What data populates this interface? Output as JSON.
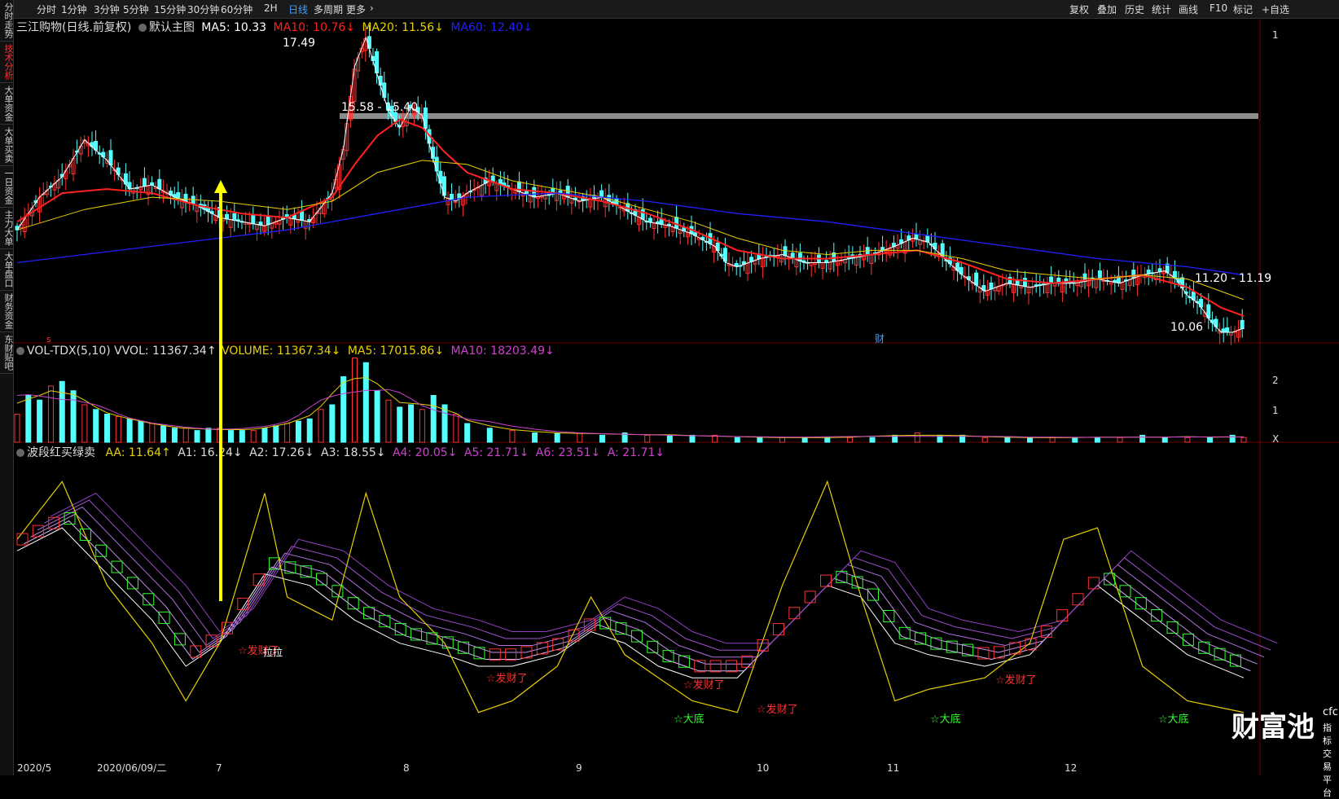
{
  "sidebar": {
    "tabs": [
      "分时走势",
      "技术分析",
      "大单资金",
      "大单买卖",
      "一日资金",
      "主力大单",
      "大单盘口",
      "财务资金",
      "东财贴吧"
    ],
    "active": 1
  },
  "toolbar": {
    "periods": [
      "分时",
      "1分钟",
      "3分钟",
      "5分钟",
      "15分钟",
      "30分钟",
      "60分钟",
      "2H",
      "日线",
      "多周期",
      "更多"
    ],
    "active_period": "日线",
    "right_buttons": [
      "复权",
      "叠加",
      "历史",
      "统计",
      "画线",
      "F10",
      "标记",
      "+自选"
    ]
  },
  "main_panel": {
    "title": "三江购物(日线.前复权)",
    "template": "默认主图",
    "ma5": "MA5: 10.33",
    "ma10": "MA10: 10.76↓",
    "ma20": "MA20: 11.56↓",
    "ma60": "MA60: 12.40↓",
    "high_label": "17.49",
    "range_label_1": "15.58 - 15.40",
    "range_label_2": "11.20 - 11.19",
    "low_label": "10.06",
    "marker_cai": "财",
    "marker_s": "s",
    "right_axis_1": "1"
  },
  "vol_panel": {
    "title": "VOL-TDX(5,10) VVOL: 11367.34↑",
    "volume": "VOLUME: 11367.34↓",
    "ma5": "MA5: 17015.86↓",
    "ma10": "MA10: 18203.49↓",
    "right_axis_1": "2",
    "right_axis_2": "1",
    "right_axis_3": "X"
  },
  "ind_panel": {
    "title": "波段红买绿卖",
    "aa": "AA: 11.64↑",
    "a1": "A1: 16.24↓",
    "a2": "A2: 17.26↓",
    "a3": "A3: 18.55↓",
    "a4": "A4: 20.05↓",
    "a5": "A5: 21.71↓",
    "a6": "A6: 23.51↓",
    "a": "A: 21.71↓",
    "signals": [
      "☆发财了",
      "☆发财了",
      "☆发财了",
      "☆发财了",
      "☆发财了"
    ],
    "bottoms": [
      "☆大底",
      "☆大底",
      "☆大底"
    ],
    "pull_label": "拉拉"
  },
  "x_axis": {
    "labels": [
      "2020/5",
      "2020/06/09/二",
      "7",
      "8",
      "9",
      "10",
      "11",
      "12"
    ]
  },
  "watermark": {
    "logo": "财富池",
    "url": "cfchi.com",
    "sub": "指标交易平台"
  },
  "colors": {
    "up": "#ff3232",
    "down": "#54ffff",
    "ma5": "#ffffff",
    "ma10": "#ff2020",
    "ma20": "#e8d000",
    "ma60": "#2020ff",
    "vol_ma5": "#e8d000",
    "vol_ma10": "#d040d0",
    "arrow": "#ffff00",
    "resistance": "#8c8c8c",
    "signal": "#ff3030",
    "bottom": "#30ff30"
  },
  "chart_data": {
    "type": "candlestick",
    "title": "三江购物(日线.前复权)",
    "price_range": [
      10.0,
      17.6
    ],
    "high": 17.49,
    "low": 10.06,
    "close_pts": [
      [
        0,
        12.6
      ],
      [
        10,
        13.4
      ],
      [
        20,
        13.9
      ],
      [
        30,
        14.8
      ],
      [
        40,
        14.3
      ],
      [
        50,
        13.6
      ],
      [
        60,
        13.7
      ],
      [
        70,
        13.4
      ],
      [
        80,
        13.2
      ],
      [
        90,
        12.9
      ],
      [
        100,
        12.8
      ],
      [
        110,
        12.7
      ],
      [
        120,
        12.9
      ],
      [
        130,
        12.8
      ],
      [
        140,
        13.5
      ],
      [
        145,
        14.6
      ],
      [
        150,
        16.6
      ],
      [
        155,
        17.3
      ],
      [
        160,
        16.4
      ],
      [
        165,
        15.5
      ],
      [
        170,
        15.1
      ],
      [
        175,
        15.6
      ],
      [
        180,
        15.4
      ],
      [
        185,
        14.3
      ],
      [
        190,
        13.4
      ],
      [
        195,
        13.3
      ],
      [
        200,
        13.5
      ],
      [
        210,
        13.8
      ],
      [
        220,
        13.6
      ],
      [
        230,
        13.4
      ],
      [
        240,
        13.5
      ],
      [
        250,
        13.3
      ],
      [
        260,
        13.4
      ],
      [
        270,
        13.1
      ],
      [
        280,
        12.8
      ],
      [
        290,
        12.7
      ],
      [
        300,
        12.5
      ],
      [
        310,
        12.2
      ],
      [
        315,
        11.8
      ],
      [
        320,
        11.7
      ],
      [
        330,
        11.9
      ],
      [
        340,
        12.0
      ],
      [
        350,
        11.8
      ],
      [
        360,
        11.8
      ],
      [
        370,
        11.9
      ],
      [
        380,
        12.0
      ],
      [
        390,
        12.2
      ],
      [
        398,
        12.4
      ],
      [
        405,
        12.3
      ],
      [
        412,
        11.9
      ],
      [
        420,
        11.5
      ],
      [
        430,
        11.1
      ],
      [
        440,
        11.3
      ],
      [
        450,
        11.2
      ],
      [
        460,
        11.3
      ],
      [
        470,
        11.3
      ],
      [
        480,
        11.4
      ],
      [
        490,
        11.3
      ],
      [
        500,
        11.5
      ],
      [
        510,
        11.6
      ],
      [
        515,
        11.4
      ],
      [
        520,
        11.0
      ],
      [
        525,
        10.8
      ],
      [
        530,
        10.4
      ],
      [
        535,
        10.1
      ],
      [
        540,
        10.1
      ],
      [
        545,
        10.2
      ]
    ],
    "ma10_pts": [
      [
        0,
        12.8
      ],
      [
        20,
        13.5
      ],
      [
        40,
        13.6
      ],
      [
        60,
        13.5
      ],
      [
        80,
        13.2
      ],
      [
        100,
        13.0
      ],
      [
        120,
        12.9
      ],
      [
        140,
        13.4
      ],
      [
        150,
        14.2
      ],
      [
        160,
        14.9
      ],
      [
        170,
        15.3
      ],
      [
        180,
        15.1
      ],
      [
        190,
        14.5
      ],
      [
        200,
        14.0
      ],
      [
        210,
        13.8
      ],
      [
        220,
        13.6
      ],
      [
        240,
        13.5
      ],
      [
        260,
        13.3
      ],
      [
        280,
        13.0
      ],
      [
        300,
        12.6
      ],
      [
        320,
        12.1
      ],
      [
        340,
        11.9
      ],
      [
        360,
        11.9
      ],
      [
        380,
        12.0
      ],
      [
        400,
        12.1
      ],
      [
        420,
        11.8
      ],
      [
        440,
        11.4
      ],
      [
        460,
        11.3
      ],
      [
        480,
        11.4
      ],
      [
        500,
        11.5
      ],
      [
        520,
        11.2
      ],
      [
        535,
        10.7
      ],
      [
        545,
        10.5
      ]
    ],
    "ma20_pts": [
      [
        0,
        12.6
      ],
      [
        30,
        13.1
      ],
      [
        60,
        13.4
      ],
      [
        90,
        13.3
      ],
      [
        120,
        13.1
      ],
      [
        140,
        13.3
      ],
      [
        160,
        14.0
      ],
      [
        180,
        14.3
      ],
      [
        200,
        14.2
      ],
      [
        220,
        13.8
      ],
      [
        240,
        13.6
      ],
      [
        260,
        13.4
      ],
      [
        280,
        13.1
      ],
      [
        300,
        12.8
      ],
      [
        320,
        12.4
      ],
      [
        340,
        12.1
      ],
      [
        360,
        12.0
      ],
      [
        380,
        12.1
      ],
      [
        400,
        12.1
      ],
      [
        420,
        11.9
      ],
      [
        440,
        11.6
      ],
      [
        460,
        11.5
      ],
      [
        480,
        11.4
      ],
      [
        500,
        11.5
      ],
      [
        520,
        11.4
      ],
      [
        545,
        10.9
      ]
    ],
    "ma60_pts": [
      [
        0,
        11.8
      ],
      [
        60,
        12.2
      ],
      [
        120,
        12.6
      ],
      [
        160,
        13.0
      ],
      [
        200,
        13.4
      ],
      [
        240,
        13.5
      ],
      [
        280,
        13.3
      ],
      [
        320,
        13.0
      ],
      [
        360,
        12.8
      ],
      [
        400,
        12.5
      ],
      [
        440,
        12.2
      ],
      [
        480,
        11.9
      ],
      [
        520,
        11.7
      ],
      [
        545,
        11.5
      ]
    ],
    "volume": [
      [
        0,
        12
      ],
      [
        5,
        20
      ],
      [
        10,
        18
      ],
      [
        15,
        24
      ],
      [
        20,
        26
      ],
      [
        25,
        22
      ],
      [
        30,
        16
      ],
      [
        35,
        14
      ],
      [
        40,
        12
      ],
      [
        45,
        11
      ],
      [
        50,
        10
      ],
      [
        55,
        9
      ],
      [
        60,
        8
      ],
      [
        65,
        7
      ],
      [
        70,
        6
      ],
      [
        75,
        6
      ],
      [
        80,
        5
      ],
      [
        85,
        6
      ],
      [
        90,
        6
      ],
      [
        95,
        5
      ],
      [
        100,
        5
      ],
      [
        105,
        5
      ],
      [
        110,
        6
      ],
      [
        115,
        7
      ],
      [
        120,
        8
      ],
      [
        125,
        9
      ],
      [
        130,
        10
      ],
      [
        135,
        14
      ],
      [
        140,
        16
      ],
      [
        145,
        28
      ],
      [
        150,
        36
      ],
      [
        155,
        34
      ],
      [
        160,
        22
      ],
      [
        165,
        18
      ],
      [
        170,
        15
      ],
      [
        175,
        16
      ],
      [
        180,
        14
      ],
      [
        185,
        20
      ],
      [
        190,
        16
      ],
      [
        195,
        12
      ],
      [
        200,
        8
      ],
      [
        210,
        6
      ],
      [
        220,
        5
      ],
      [
        230,
        4
      ],
      [
        240,
        4
      ],
      [
        250,
        4
      ],
      [
        260,
        3
      ],
      [
        270,
        4
      ],
      [
        280,
        3
      ],
      [
        290,
        3
      ],
      [
        300,
        3
      ],
      [
        310,
        3
      ],
      [
        320,
        2
      ],
      [
        330,
        2
      ],
      [
        340,
        2
      ],
      [
        350,
        2
      ],
      [
        360,
        2
      ],
      [
        370,
        2
      ],
      [
        380,
        2
      ],
      [
        390,
        3
      ],
      [
        400,
        4
      ],
      [
        410,
        3
      ],
      [
        420,
        3
      ],
      [
        430,
        2
      ],
      [
        440,
        2
      ],
      [
        450,
        2
      ],
      [
        460,
        2
      ],
      [
        470,
        2
      ],
      [
        480,
        2
      ],
      [
        490,
        2
      ],
      [
        500,
        3
      ],
      [
        510,
        2
      ],
      [
        520,
        2
      ],
      [
        530,
        2
      ],
      [
        540,
        3
      ],
      [
        545,
        2
      ]
    ],
    "indicator_lines": {
      "aa": [
        [
          0,
          17
        ],
        [
          20,
          22
        ],
        [
          40,
          13
        ],
        [
          60,
          8
        ],
        [
          75,
          3
        ],
        [
          90,
          8
        ],
        [
          110,
          21
        ],
        [
          120,
          12
        ],
        [
          140,
          10
        ],
        [
          155,
          21
        ],
        [
          170,
          12
        ],
        [
          190,
          8
        ],
        [
          205,
          2
        ],
        [
          220,
          3
        ],
        [
          240,
          6
        ],
        [
          255,
          12
        ],
        [
          270,
          7
        ],
        [
          285,
          5
        ],
        [
          300,
          3
        ],
        [
          320,
          2
        ],
        [
          340,
          13
        ],
        [
          360,
          22
        ],
        [
          375,
          12
        ],
        [
          390,
          3
        ],
        [
          405,
          4
        ],
        [
          430,
          5
        ],
        [
          450,
          8
        ],
        [
          465,
          17
        ],
        [
          480,
          18
        ],
        [
          500,
          6
        ],
        [
          520,
          3
        ],
        [
          545,
          2
        ]
      ],
      "a1": [
        [
          0,
          16
        ],
        [
          20,
          18
        ],
        [
          40,
          14
        ],
        [
          60,
          10
        ],
        [
          75,
          6
        ],
        [
          90,
          8
        ],
        [
          110,
          14
        ],
        [
          130,
          13
        ],
        [
          150,
          10
        ],
        [
          170,
          8
        ],
        [
          190,
          7
        ],
        [
          205,
          6
        ],
        [
          220,
          6
        ],
        [
          240,
          7
        ],
        [
          255,
          9
        ],
        [
          270,
          8
        ],
        [
          285,
          6
        ],
        [
          300,
          5
        ],
        [
          320,
          5
        ],
        [
          340,
          9
        ],
        [
          360,
          13
        ],
        [
          375,
          12
        ],
        [
          390,
          8
        ],
        [
          405,
          7
        ],
        [
          430,
          6
        ],
        [
          450,
          7
        ],
        [
          465,
          10
        ],
        [
          480,
          13
        ],
        [
          500,
          10
        ],
        [
          520,
          7
        ],
        [
          545,
          5
        ]
      ]
    }
  }
}
